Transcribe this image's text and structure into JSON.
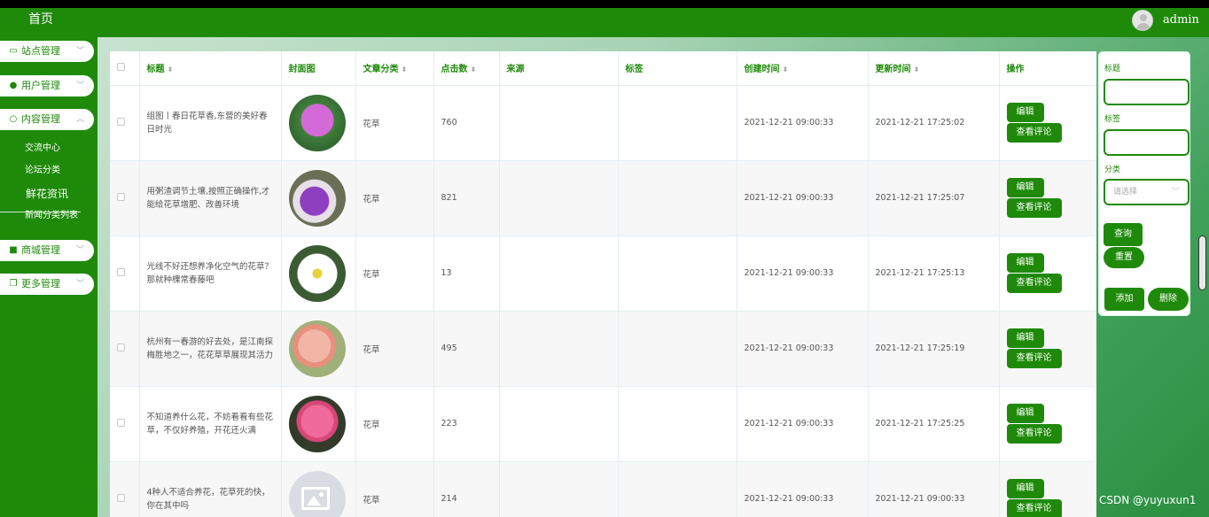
{
  "sidebar": {
    "home": "首页",
    "menus": [
      {
        "label": "站点管理",
        "icon": "monitor-icon"
      },
      {
        "label": "用户管理",
        "icon": "user-icon"
      },
      {
        "label": "内容管理",
        "icon": "chat-icon"
      },
      {
        "label": "商城管理",
        "icon": "lock-icon"
      },
      {
        "label": "更多管理",
        "icon": "copy-icon"
      }
    ],
    "sub_items": [
      "交流中心",
      "论坛分类",
      "鲜花资讯",
      "新闻分类列表"
    ]
  },
  "header": {
    "username": "admin"
  },
  "table": {
    "headers": [
      "标题",
      "封面图",
      "文章分类",
      "点击数",
      "来源",
      "标签",
      "创建时间",
      "更新时间",
      "操作"
    ],
    "edit_label": "编辑",
    "comment_label": "查看评论",
    "rows": [
      {
        "title": "组图丨春日花草香,东营的美好春日时光",
        "category": "花草",
        "clicks": "760",
        "source": "",
        "tags": "",
        "created": "2021-12-21 09:00:33",
        "updated": "2021-12-21 17:25:02"
      },
      {
        "title": "用粥渣调节土壤,按照正确操作,才能给花草增肥、改善环境",
        "category": "花草",
        "clicks": "821",
        "source": "",
        "tags": "",
        "created": "2021-12-21 09:00:33",
        "updated": "2021-12-21 17:25:07"
      },
      {
        "title": "光线不好还想养净化空气的花草？那就种棵常春藤吧",
        "category": "花草",
        "clicks": "13",
        "source": "",
        "tags": "",
        "created": "2021-12-21 09:00:33",
        "updated": "2021-12-21 17:25:13"
      },
      {
        "title": "杭州有一春游的好去处，是江南探梅胜地之一，花花草草展现其活力",
        "category": "花草",
        "clicks": "495",
        "source": "",
        "tags": "",
        "created": "2021-12-21 09:00:33",
        "updated": "2021-12-21 17:25:19"
      },
      {
        "title": "不知道养什么花，不妨看看有些花草，不仅好养殖，开花还火满",
        "category": "花草",
        "clicks": "223",
        "source": "",
        "tags": "",
        "created": "2021-12-21 09:00:33",
        "updated": "2021-12-21 17:25:25"
      },
      {
        "title": "4种人不适合养花，花草死的快，你在其中吗",
        "category": "花草",
        "clicks": "214",
        "source": "",
        "tags": "",
        "created": "2021-12-21 09:00:33",
        "updated": "2021-12-21 09:00:33"
      }
    ]
  },
  "search": {
    "title_label": "标题",
    "tag_label": "标签",
    "category_label": "分类",
    "category_placeholder": "请选择",
    "query_label": "查询",
    "reset_label": "重置",
    "add_label": "添加",
    "delete_label": "删除"
  },
  "watermark": "CSDN @yuyuxun1"
}
